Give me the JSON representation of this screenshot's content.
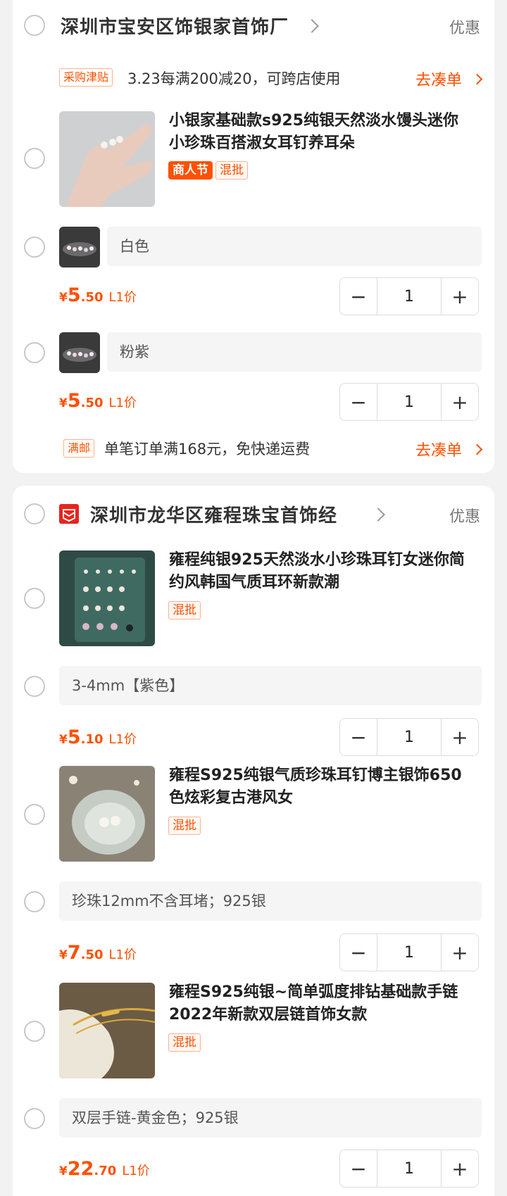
{
  "shops": [
    {
      "name": "深圳市宝安区饰银家首饰厂",
      "youhui": "优惠",
      "promo_tag": "采购津贴",
      "promo_text": "3.23每满200减20，可跨店使用",
      "promo_link": "去凑单",
      "product": {
        "title": "小银家基础款s925纯银天然淡水馒头迷你小珍珠百搭淑女耳钉养耳朵",
        "tag_solid": "商人节",
        "tag_mix": "混批"
      },
      "skus": [
        {
          "name": "白色",
          "price_cur": "¥",
          "price_int": "5",
          "price_dec": ".50",
          "level": "L1价",
          "qty": "1"
        },
        {
          "name": "粉紫",
          "price_cur": "¥",
          "price_int": "5",
          "price_dec": ".50",
          "level": "L1价",
          "qty": "1"
        }
      ],
      "ship_tag": "满邮",
      "ship_text": "单笔订单满168元，免快递运费",
      "ship_link": "去凑单"
    },
    {
      "name": "深圳市龙华区雍程珠宝首饰经",
      "youhui": "优惠",
      "products": [
        {
          "title": "雍程纯银925天然淡水小珍珠耳钉女迷你简约风韩国气质耳环新款潮",
          "tag_mix": "混批",
          "sku": "3-4mm【紫色】",
          "price_cur": "¥",
          "price_int": "5",
          "price_dec": ".10",
          "level": "L1价",
          "qty": "1"
        },
        {
          "title": "雍程S925纯银气质珍珠耳钉博主银饰650色炫彩复古港风女",
          "tag_mix": "混批",
          "sku": "珍珠12mm不含耳堵；925银",
          "price_cur": "¥",
          "price_int": "7",
          "price_dec": ".50",
          "level": "L1价",
          "qty": "1"
        },
        {
          "title": "雍程S925纯银~简单弧度排钻基础款手链2022年新款双层链首饰女款",
          "tag_mix": "混批",
          "sku": "双层手链-黄金色；925银",
          "price_cur": "¥",
          "price_int": "22",
          "price_dec": ".70",
          "level": "L1价",
          "qty": "1"
        }
      ]
    }
  ],
  "stepper": {
    "minus": "−",
    "plus": "+"
  },
  "colors": {
    "accent": "#ff5000",
    "background": "#f2f2f2",
    "shop_icon": "#e8241c"
  }
}
